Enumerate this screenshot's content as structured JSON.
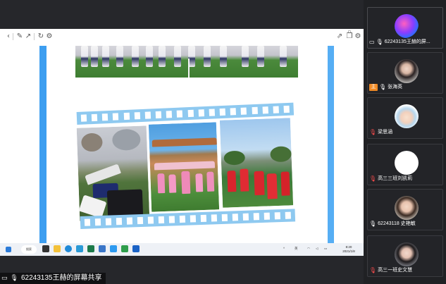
{
  "shared_screen": {
    "toolbar": {
      "back_icon": "chevron-left-icon",
      "pen_icon": "pen-icon",
      "pointer_icon": "pointer-icon",
      "refresh_icon": "refresh-icon",
      "settings_icon": "gear-icon"
    },
    "taskbar": {
      "search_label": "搜索",
      "tray_text": "英",
      "clock_time": "8:20",
      "clock_date": "2021/1/8"
    }
  },
  "share_label": "62243135王赫的屏幕共享",
  "participants": [
    {
      "name": "62243135王赫的屏...",
      "muted": false,
      "avatar": "windows-swirl"
    },
    {
      "name": "张海英",
      "host": true,
      "muted": false,
      "avatar": "photo-woman"
    },
    {
      "name": "梁思涵",
      "muted": true,
      "avatar": "cartoon-girl"
    },
    {
      "name": "高三三班刘凯莉",
      "muted": true,
      "avatar": "blank-white"
    },
    {
      "name": "62243118 史艳敏",
      "muted": false,
      "avatar": "photo-girl"
    },
    {
      "name": "高三一班史文慧",
      "muted": true,
      "avatar": "photo-girl-dark"
    }
  ],
  "colors": {
    "accent_blue": "#3d9ef0",
    "film_blue": "#8ec9f0",
    "host_badge": "#f08a24",
    "background": "#202124"
  }
}
